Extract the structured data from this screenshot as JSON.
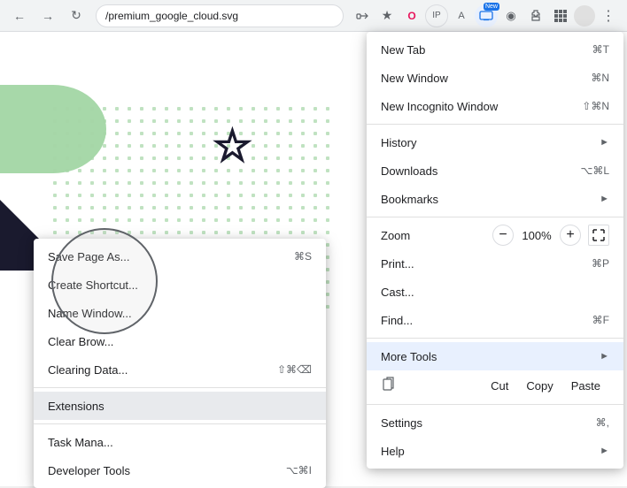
{
  "browser": {
    "address": "/premium_google_cloud.svg",
    "toolbar_icons": [
      "share",
      "bookmark",
      "opera",
      "ip-extension",
      "translate",
      "screencast",
      "color-picker",
      "extensions",
      "more"
    ]
  },
  "main_menu": {
    "items": [
      {
        "label": "New Tab",
        "shortcut": "⌘T",
        "arrow": false
      },
      {
        "label": "New Window",
        "shortcut": "⌘N",
        "arrow": false
      },
      {
        "label": "New Incognito Window",
        "shortcut": "⇧⌘N",
        "arrow": false
      },
      {
        "divider": true
      },
      {
        "label": "History",
        "shortcut": "",
        "arrow": true
      },
      {
        "label": "Downloads",
        "shortcut": "⌥⌘L",
        "arrow": false
      },
      {
        "label": "Bookmarks",
        "shortcut": "",
        "arrow": true
      },
      {
        "divider": true
      },
      {
        "label": "Zoom",
        "type": "zoom",
        "minus": "−",
        "value": "100%",
        "plus": "+"
      },
      {
        "label": "Print...",
        "shortcut": "⌘P",
        "arrow": false
      },
      {
        "label": "Cast...",
        "shortcut": "",
        "arrow": false
      },
      {
        "label": "Find...",
        "shortcut": "⌘F",
        "arrow": false
      },
      {
        "divider": true
      },
      {
        "label": "More Tools",
        "shortcut": "",
        "arrow": true,
        "highlighted": true
      },
      {
        "type": "ccp",
        "cut": "Cut",
        "copy": "Copy",
        "paste": "Paste"
      },
      {
        "divider": true
      },
      {
        "label": "Settings",
        "shortcut": "⌘,",
        "arrow": false
      },
      {
        "label": "Help",
        "shortcut": "",
        "arrow": true
      }
    ]
  },
  "sub_menu": {
    "items": [
      {
        "label": "Save Page As...",
        "shortcut": "⌘S"
      },
      {
        "label": "Create Shortcut...",
        "shortcut": ""
      },
      {
        "label": "Name Window...",
        "shortcut": ""
      },
      {
        "label": "Clear Brow...",
        "shortcut": "",
        "partial": true
      },
      {
        "label": "Clearing Data...",
        "shortcut": "⇧⌘⌫",
        "partial": true
      },
      {
        "divider": true
      },
      {
        "label": "Extensions",
        "shortcut": "",
        "highlighted": true
      },
      {
        "divider": true
      },
      {
        "label": "Task Mana...",
        "shortcut": "",
        "partial": true
      },
      {
        "label": "Developer Tools",
        "shortcut": "⌥⌘I"
      }
    ]
  }
}
